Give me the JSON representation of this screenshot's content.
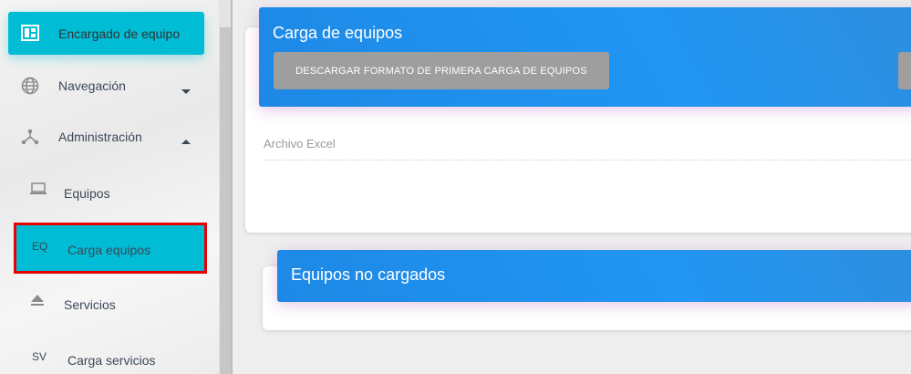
{
  "sidebar": {
    "items": [
      {
        "label": "Encargado de equipo",
        "icon": "dashboard-icon"
      },
      {
        "label": "Navegación",
        "icon": "globe-icon"
      },
      {
        "label": "Administración",
        "icon": "hierarchy-icon"
      }
    ],
    "subitems": [
      {
        "label": "Equipos",
        "icon": "laptop-icon"
      },
      {
        "mini": "EQ",
        "label": "Carga equipos"
      },
      {
        "label": "Servicios",
        "icon": "eject-icon"
      },
      {
        "mini": "SV",
        "label": "Carga servicios"
      }
    ]
  },
  "main": {
    "upload_card": {
      "title": "Carga de equipos",
      "download_button": "DESCARGAR FORMATO DE PRIMERA CARGA DE EQUIPOS",
      "file_field_label": "Archivo Excel"
    },
    "results_card": {
      "title": "Equipos no cargados"
    }
  },
  "colors": {
    "accent_cyan": "#00bcd4",
    "header_blue": "#1e88e5",
    "highlight_red": "#e60000",
    "button_gray": "#9e9e9e"
  }
}
